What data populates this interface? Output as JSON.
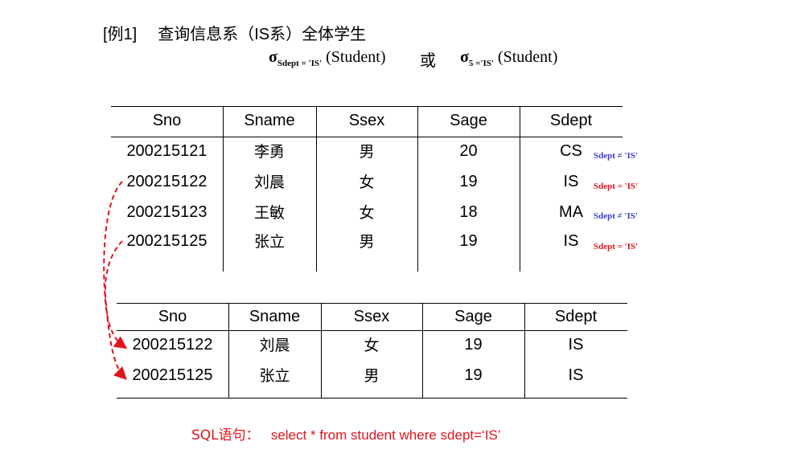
{
  "title": {
    "example": "[例1]",
    "text": "查询信息系（IS系）全体学生"
  },
  "formula": {
    "f1": {
      "sigma": "σ",
      "sub": "Sdept = 'IS'",
      "arg": "(Student)"
    },
    "or": "或",
    "f2": {
      "sigma": "σ",
      "sub": "5 ='IS'",
      "arg": "(Student)"
    }
  },
  "source_table": {
    "columns": [
      "Sno",
      "Sname",
      "Ssex",
      "Sage",
      "Sdept"
    ],
    "rows": [
      [
        "200215121",
        "李勇",
        "男",
        "20",
        "CS"
      ],
      [
        "200215122",
        "刘晨",
        "女",
        "19",
        "IS"
      ],
      [
        "200215123",
        "王敏",
        "女",
        "18",
        "MA"
      ],
      [
        "200215125",
        "张立",
        "男",
        "19",
        "IS"
      ]
    ],
    "conditions": [
      {
        "text": "Sdept ≠ 'IS'",
        "color": "#3a3ad8"
      },
      {
        "text": "Sdept = 'IS'",
        "color": "#e0141e"
      },
      {
        "text": "Sdept ≠ 'IS'",
        "color": "#3a3ad8"
      },
      {
        "text": "Sdept = 'IS'",
        "color": "#e0141e"
      }
    ]
  },
  "result_table": {
    "columns": [
      "Sno",
      "Sname",
      "Ssex",
      "Sage",
      "Sdept"
    ],
    "rows": [
      [
        "200215122",
        "刘晨",
        "女",
        "19",
        "IS"
      ],
      [
        "200215125",
        "张立",
        "男",
        "19",
        "IS"
      ]
    ]
  },
  "sql": {
    "label": "SQL语句：",
    "query": "select  * from student where sdept=‘IS’"
  },
  "colors": {
    "arrow": "#e0141e",
    "red": "#e0141e",
    "blue": "#3a3ad8"
  }
}
